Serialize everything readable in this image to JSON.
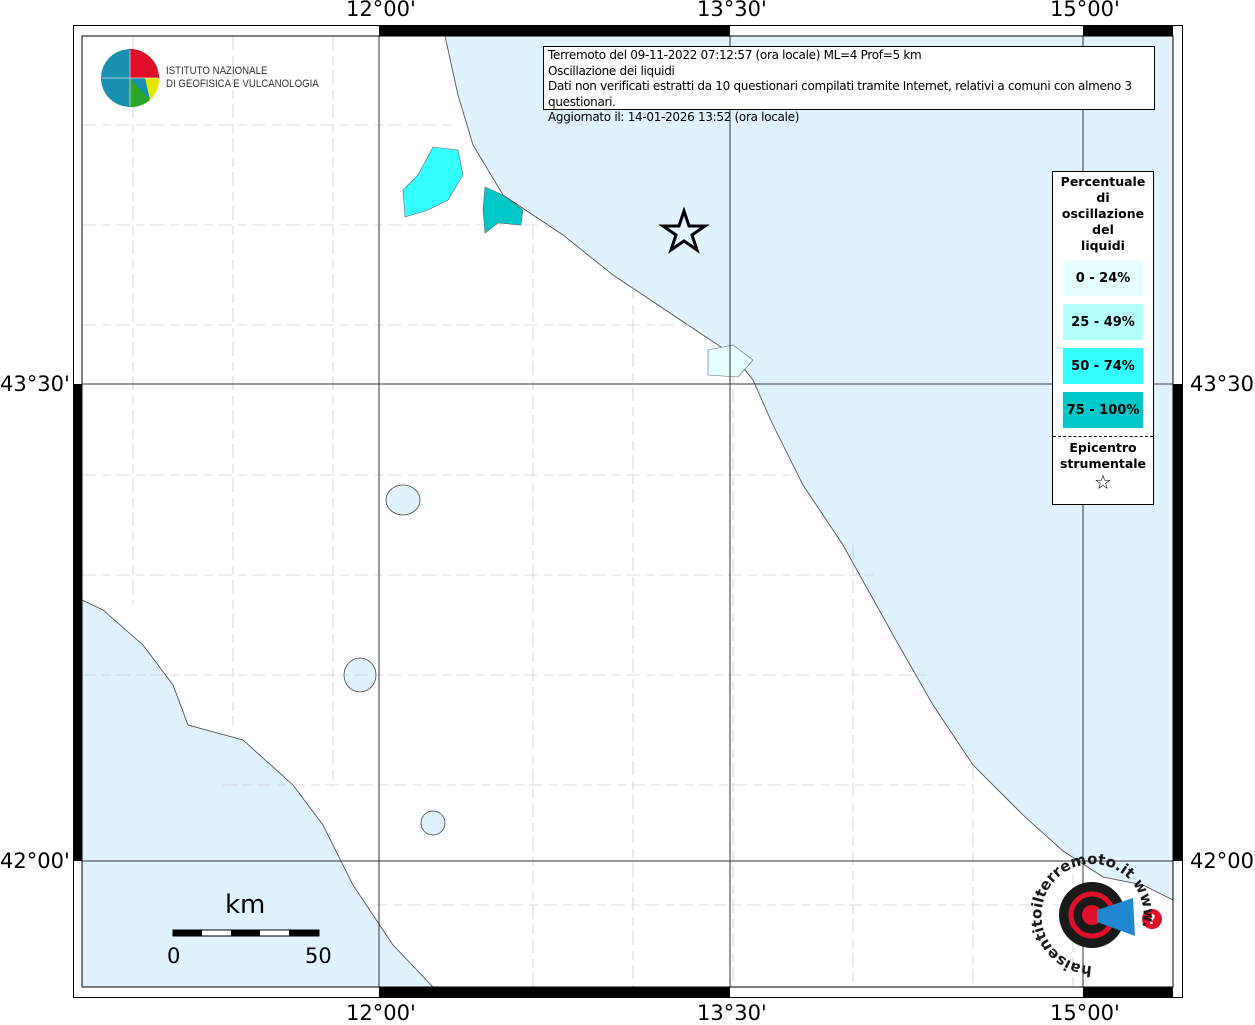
{
  "info_box": {
    "lines": [
      "Terremoto del 09-11-2022 07:12:57 (ora locale) ML=4 Prof=5 km",
      "Oscillazione dei liquidi",
      "Dati non verificati estratti da 10 questionari compilati tramite Internet, relativi a comuni con almeno 3 questionari.",
      "Aggiornato il: 14-01-2026 13:52 (ora locale)"
    ]
  },
  "logo": {
    "ingv_line1": "ISTITUTO NAZIONALE",
    "ingv_line2": "DI GEOFISICA E VULCANOLOGIA",
    "hst": "haisentitoilterremoto.it www."
  },
  "axes": {
    "lon_top": [
      "12°00'",
      "13°30'",
      "15°00'"
    ],
    "lon_bottom": [
      "12°00'",
      "13°30'",
      "15°00'"
    ],
    "lat_left": [
      "43°30'",
      "42°00'"
    ],
    "lat_right": [
      "43°30'",
      "42°00'"
    ]
  },
  "legend": {
    "title_lines": [
      "Percentuale",
      "di",
      "oscillazione",
      "del",
      "liquidi"
    ],
    "classes": [
      {
        "label": "0 - 24%",
        "color": "#e6ffff"
      },
      {
        "label": "25 - 49%",
        "color": "#b3ffff"
      },
      {
        "label": "50 - 74%",
        "color": "#33ffff"
      },
      {
        "label": "75 - 100%",
        "color": "#00c8c8"
      }
    ],
    "epicenter_lines": [
      "Epicentro",
      "strumentale"
    ]
  },
  "scale_bar": {
    "unit": "km",
    "min": "0",
    "max": "50"
  },
  "colors": {
    "sea": "#e0f2fc",
    "land": "#ffffff"
  }
}
